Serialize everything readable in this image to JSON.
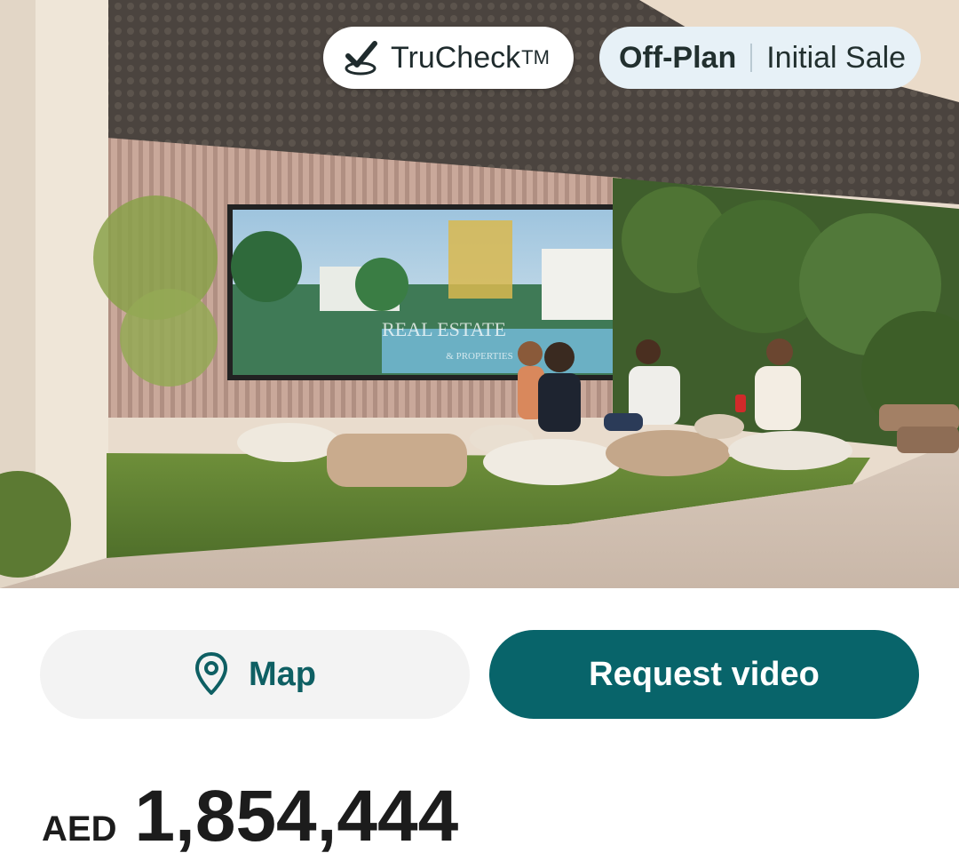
{
  "hero": {
    "image_description_icon": "property-photo",
    "watermark_text": "REAL ESTATE",
    "watermark_subtext": "& PROPERTIES"
  },
  "badges": {
    "trucheck_label": "TruCheck",
    "trucheck_trademark": "TM",
    "status_primary": "Off-Plan",
    "status_secondary": "Initial Sale"
  },
  "actions": {
    "map_label": "Map",
    "request_video_label": "Request video"
  },
  "price": {
    "currency": "AED",
    "amount": "1,854,444"
  },
  "colors": {
    "accent": "#08646a",
    "map_text": "#0e5f63",
    "status_badge_bg": "#e7f1f7"
  },
  "icons": {
    "trucheck": "check-icon",
    "map": "map-pin-icon"
  }
}
